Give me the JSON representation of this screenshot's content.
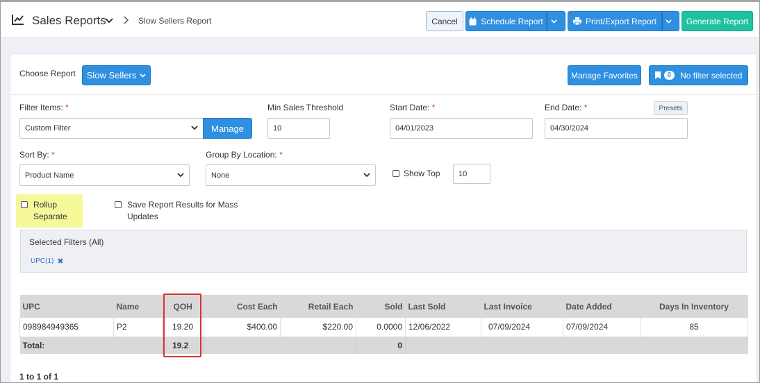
{
  "header": {
    "title": "Sales Reports",
    "breadcrumb": "Slow Sellers Report",
    "icon": "line-chart-icon"
  },
  "toolbar": {
    "cancel_label": "Cancel",
    "schedule_label": "Schedule Report",
    "print_label": "Print/Export Report",
    "generate_label": "Generate Report"
  },
  "report_picker": {
    "label": "Choose Report",
    "selected": "Slow Sellers",
    "manage_favorites_label": "Manage Favorites",
    "filter_count": "0",
    "filter_status": "No filter selected"
  },
  "form": {
    "filter_items": {
      "label": "Filter Items:",
      "value": "Custom Filter",
      "manage_label": "Manage"
    },
    "min_sales": {
      "label": "Min Sales Threshold",
      "value": "10"
    },
    "start_date": {
      "label": "Start Date:",
      "value": "04/01/2023"
    },
    "end_date": {
      "label": "End Date:",
      "value": "04/30/2024"
    },
    "presets_label": "Presets",
    "sort_by": {
      "label": "Sort By:",
      "value": "Product Name"
    },
    "group_by": {
      "label": "Group By Location:",
      "value": "None"
    },
    "show_top": {
      "label": "Show Top",
      "value": "10"
    },
    "rollup": {
      "line1": "Rollup",
      "line2": "Separate"
    },
    "save_results": {
      "line1": "Save Report Results for Mass",
      "line2": "Updates"
    },
    "required_mark": "*"
  },
  "selected_filters": {
    "title": "Selected Filters (All)",
    "tags": [
      "UPC(1)"
    ],
    "remove_glyph": "✖"
  },
  "table": {
    "headers": [
      "UPC",
      "Name",
      "QOH",
      "Cost Each",
      "Retail Each",
      "Sold",
      "Last Sold",
      "Last Invoice",
      "Date Added",
      "Days In Inventory"
    ],
    "rows": [
      [
        "098984949365",
        "P2",
        "19.20",
        "$400.00",
        "$220.00",
        "0.0000",
        "12/06/2022",
        "07/09/2024",
        "07/09/2024",
        "85"
      ]
    ],
    "total": {
      "label": "Total:",
      "qoh": "19.2",
      "sold": "0"
    }
  },
  "pagination": {
    "text": "1 to 1 of 1"
  },
  "colors": {
    "primary": "#2f8fe0",
    "generate": "#1fc2a0",
    "highlight": "#f5f99a",
    "annotation": "#d9342b"
  }
}
